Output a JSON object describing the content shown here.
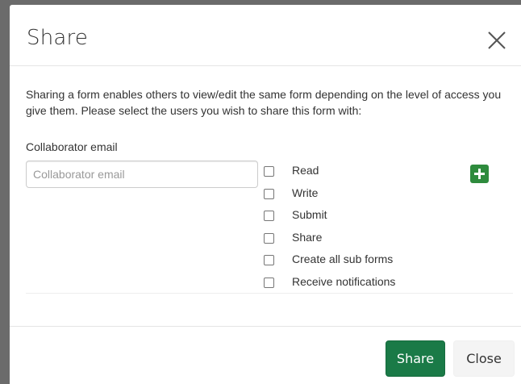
{
  "modal": {
    "title": "Share",
    "description": "Sharing a form enables others to view/edit the same form depending on the level of access you give them. Please select the users you wish to share this form with:",
    "email_label": "Collaborator email",
    "email_placeholder": "Collaborator email",
    "email_value": "",
    "permissions": [
      {
        "label": "Read",
        "checked": false
      },
      {
        "label": "Write",
        "checked": false
      },
      {
        "label": "Submit",
        "checked": false
      },
      {
        "label": "Share",
        "checked": false
      },
      {
        "label": "Create all sub forms",
        "checked": false
      },
      {
        "label": "Receive notifications",
        "checked": false
      }
    ],
    "add_icon": "plus-icon",
    "close_icon": "close-icon"
  },
  "footer": {
    "share_label": "Share",
    "close_label": "Close"
  },
  "colors": {
    "primary_green": "#1a7a47",
    "add_green": "#2e8b3d",
    "overlay": "#6b6b6b"
  }
}
